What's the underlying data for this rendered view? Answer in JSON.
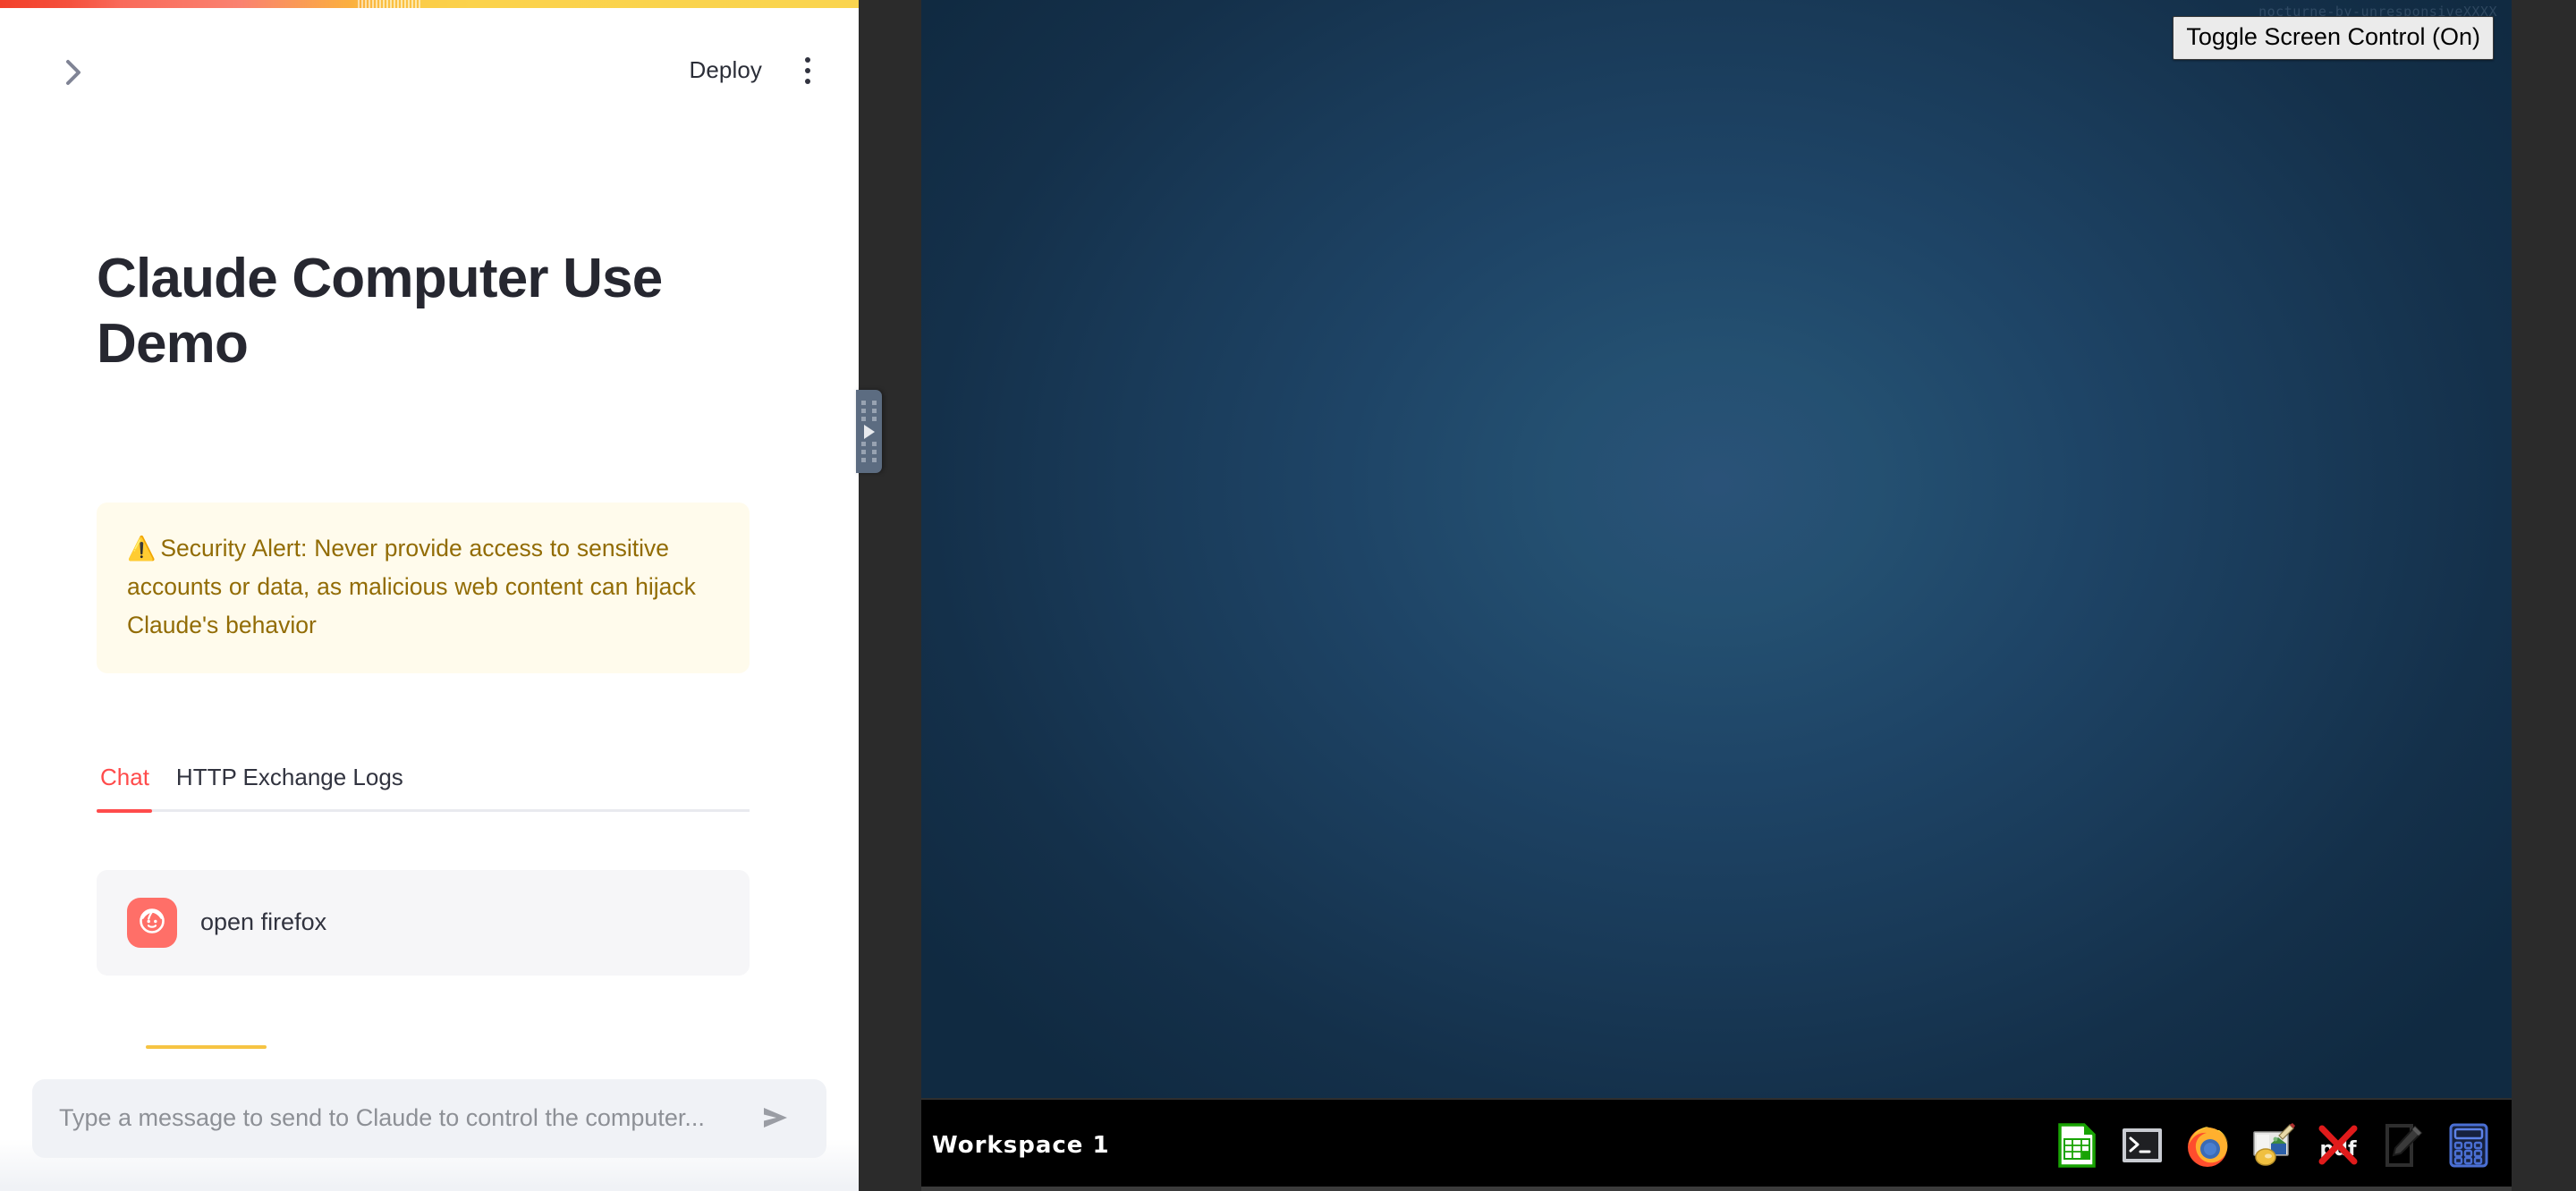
{
  "app": {
    "streamlit_panel": {
      "header": {
        "expand_icon": "chevron-right-icon",
        "deploy_label": "Deploy",
        "menu_icon": "kebab-menu-icon"
      },
      "title": "Claude Computer Use Demo",
      "alert": {
        "icon": "warning-triangle-icon",
        "glyph": "⚠️",
        "text": "Security Alert: Never provide access to sensitive accounts or data, as malicious web content can hijack Claude's behavior",
        "bg_color": "#fffbec",
        "text_color": "#926c05"
      },
      "tabs": [
        {
          "label": "Chat",
          "active": true
        },
        {
          "label": "HTTP Exchange Logs",
          "active": false
        }
      ],
      "accent_color": "#ff4b4b",
      "messages": [
        {
          "avatar": "user-face-avatar",
          "avatar_color": "#ff6f68",
          "text": "open firefox"
        }
      ],
      "chat_input": {
        "placeholder": "Type a message to send to Claude to control the computer...",
        "value": "",
        "send_icon": "send-arrow-icon"
      }
    },
    "vnc": {
      "handle": {
        "grip_icon": "drag-grip-icon",
        "expand_icon": "play-triangle-icon"
      },
      "ghost_text": "nocturne-by-unresponsiveXXXX",
      "toggle_button_label": "Toggle Screen Control (On)",
      "desktop_color": "#1e4466",
      "taskbar": {
        "workspace_label": "Workspace 1",
        "tray_icons": [
          {
            "name": "libreoffice-calc-icon",
            "title": "LibreOffice Calc"
          },
          {
            "name": "terminal-icon",
            "title": "Terminal"
          },
          {
            "name": "firefox-icon",
            "title": "Firefox"
          },
          {
            "name": "image-editor-icon",
            "title": "GIMP"
          },
          {
            "name": "pdf-viewer-icon",
            "title": "PDF Viewer"
          },
          {
            "name": "text-editor-icon",
            "title": "Text Editor"
          },
          {
            "name": "calculator-icon",
            "title": "Calculator"
          }
        ]
      }
    }
  }
}
